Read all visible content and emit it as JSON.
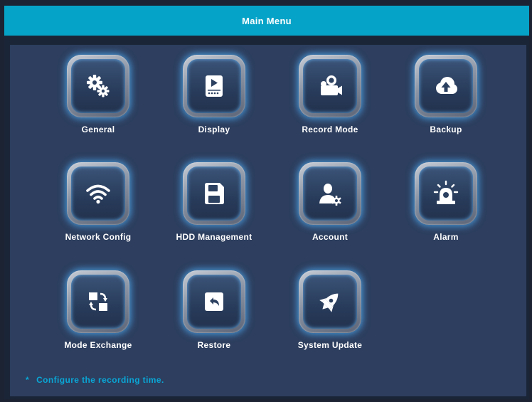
{
  "window": {
    "title": "Main Menu"
  },
  "menu": [
    {
      "label": "General",
      "icon": "gears-icon"
    },
    {
      "label": "Display",
      "icon": "display-icon"
    },
    {
      "label": "Record Mode",
      "icon": "camera-icon"
    },
    {
      "label": "Backup",
      "icon": "cloud-upload-icon"
    },
    {
      "label": "Network Config",
      "icon": "wifi-icon"
    },
    {
      "label": "HDD Management",
      "icon": "floppy-disk-icon"
    },
    {
      "label": "Account",
      "icon": "user-settings-icon"
    },
    {
      "label": "Alarm",
      "icon": "alarm-light-icon"
    },
    {
      "label": "Mode Exchange",
      "icon": "exchange-icon"
    },
    {
      "label": "Restore",
      "icon": "restore-icon"
    },
    {
      "label": "System Update",
      "icon": "rocket-icon"
    }
  ],
  "hint": {
    "marker": "*",
    "text": "Configure the recording time."
  },
  "colors": {
    "titlebar": "#06a3c8",
    "panel": "#2d3e5e",
    "hint": "#0aa6d6",
    "glow": "#50b4ff"
  }
}
